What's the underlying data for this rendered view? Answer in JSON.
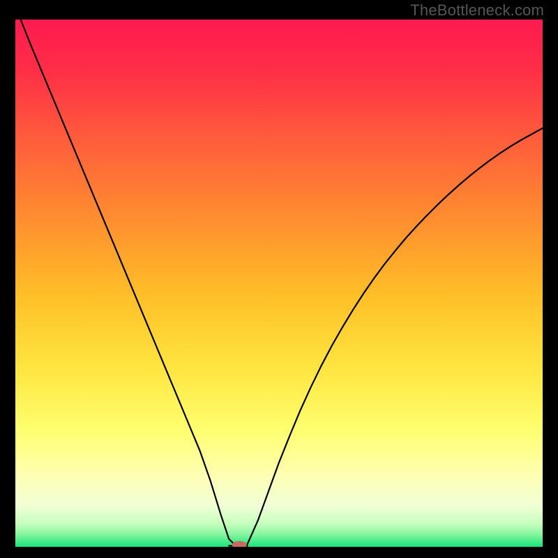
{
  "watermark": "TheBottleneck.com",
  "chart_data": {
    "type": "line",
    "title": "",
    "xlabel": "",
    "ylabel": "",
    "xlim": [
      0,
      100
    ],
    "ylim": [
      0,
      100
    ],
    "grid": false,
    "legend": false,
    "background_gradient": {
      "top_color": "#ff1a4f",
      "mid_colors": [
        "#ff5a3c",
        "#ffae24",
        "#ffe944",
        "#ffff99",
        "#f6ffe1"
      ],
      "bottom_color": "#18e57a"
    },
    "marker": {
      "x": 42.5,
      "y": 0,
      "color": "#c96a61",
      "rx": 1.4,
      "ry": 0.7
    },
    "series": [
      {
        "name": "left-arm",
        "stroke": "#000000",
        "stroke_width": 2.2,
        "x": [
          1,
          3,
          5,
          7,
          9,
          11,
          13,
          15,
          17,
          19,
          21,
          23,
          25,
          27,
          29,
          31,
          33,
          35,
          37,
          39,
          40.5,
          42
        ],
        "y": [
          100,
          95,
          90.2,
          85.4,
          80.6,
          75.8,
          71,
          66.2,
          61.4,
          56.6,
          51.8,
          47,
          42.2,
          37.4,
          32.6,
          27.8,
          23,
          18.2,
          12.5,
          6,
          1.5,
          0
        ]
      },
      {
        "name": "flat-segment",
        "stroke": "#000000",
        "stroke_width": 2.2,
        "x": [
          40.5,
          44
        ],
        "y": [
          0.2,
          0.2
        ]
      },
      {
        "name": "right-arm",
        "stroke": "#000000",
        "stroke_width": 2.2,
        "x": [
          44,
          46,
          48,
          50,
          52,
          54,
          56,
          58,
          60,
          62,
          64,
          66,
          68,
          70,
          72,
          74,
          76,
          78,
          80,
          82,
          84,
          86,
          88,
          90,
          92,
          94,
          96,
          98,
          100
        ],
        "y": [
          0.5,
          5,
          10.5,
          16,
          21,
          25.8,
          30.2,
          34.3,
          38.1,
          41.6,
          44.9,
          48,
          50.9,
          53.6,
          56.1,
          58.5,
          60.7,
          62.8,
          64.8,
          66.7,
          68.5,
          70.2,
          71.8,
          73.3,
          74.7,
          76,
          77.2,
          78.3,
          79.4
        ]
      }
    ]
  }
}
